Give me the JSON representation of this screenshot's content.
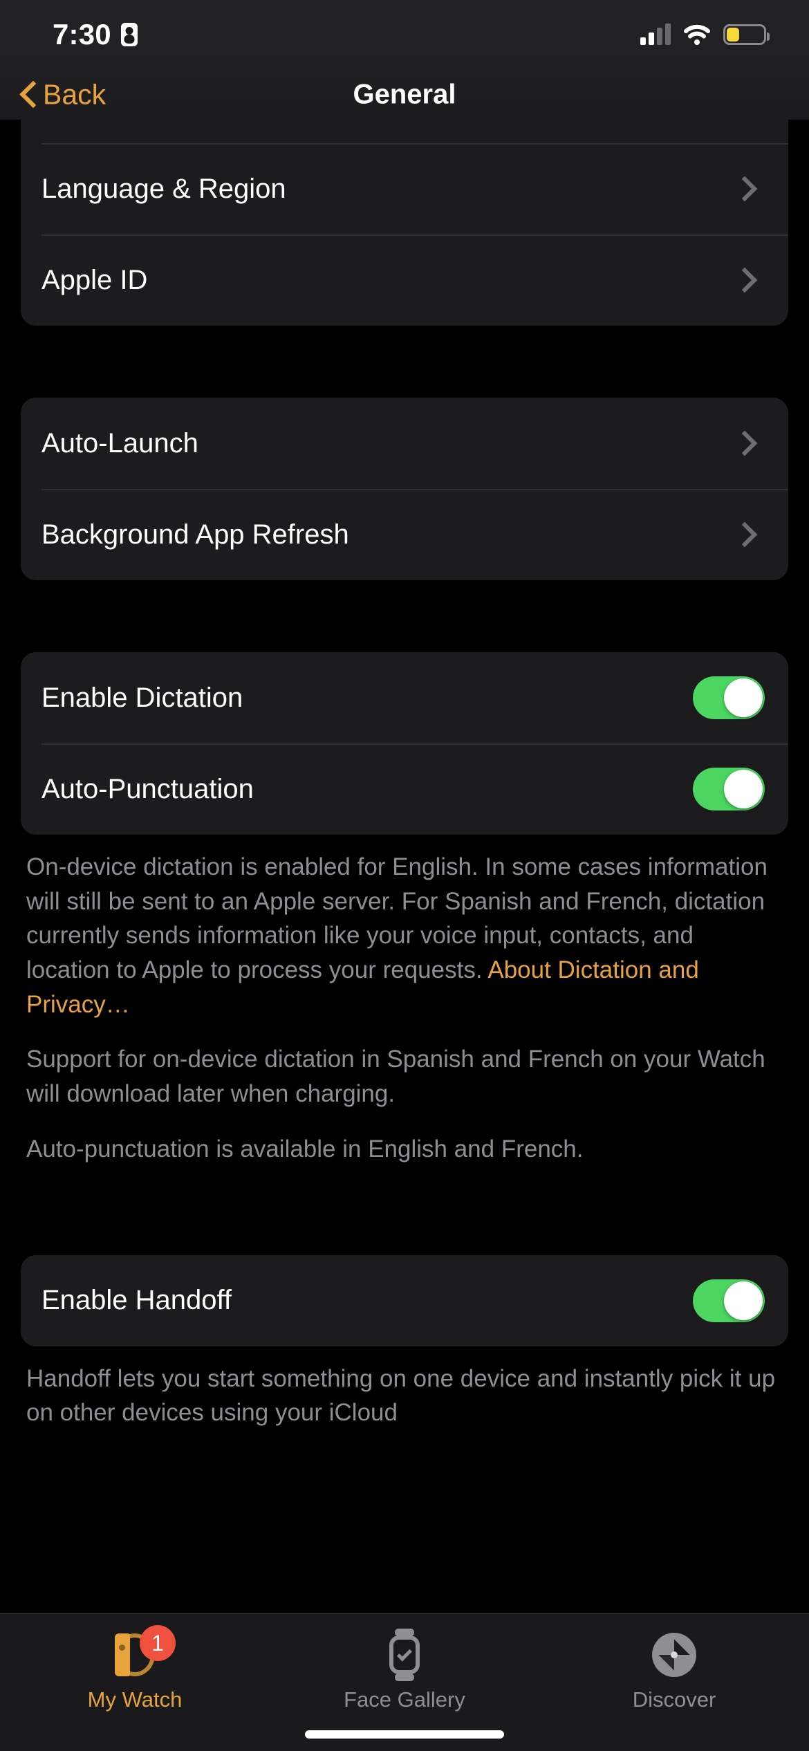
{
  "status_bar": {
    "time": "7:30",
    "recording_icon": "recording-indicator-icon",
    "cellular_icon": "cellular-signal-icon",
    "wifi_icon": "wifi-icon",
    "battery_icon": "battery-low-power-icon",
    "battery_color": "#f5d83a"
  },
  "nav": {
    "back_label": "Back",
    "title": "General",
    "accent_color": "#e8a33d"
  },
  "sections": {
    "group1": {
      "rows": [
        {
          "label": "Language & Region",
          "accessory": "chevron"
        },
        {
          "label": "Apple ID",
          "accessory": "chevron"
        }
      ]
    },
    "group2": {
      "rows": [
        {
          "label": "Auto-Launch",
          "accessory": "chevron"
        },
        {
          "label": "Background App Refresh",
          "accessory": "chevron"
        }
      ]
    },
    "group3": {
      "rows": [
        {
          "label": "Enable Dictation",
          "accessory": "toggle",
          "value": "on"
        },
        {
          "label": "Auto-Punctuation",
          "accessory": "toggle",
          "value": "on"
        }
      ],
      "footer": {
        "paragraph1_text": "On-device dictation is enabled for English. In some cases information will still be sent to an Apple server. For Spanish and French, dictation currently sends information like your voice input, contacts, and location to Apple to process your requests. ",
        "paragraph1_link": "About Dictation and Privacy…",
        "paragraph2": "Support for on-device dictation in Spanish and French on your Watch will download later when charging.",
        "paragraph3": "Auto-punctuation is available in English and French."
      }
    },
    "group4": {
      "rows": [
        {
          "label": "Enable Handoff",
          "accessory": "toggle",
          "value": "on"
        }
      ],
      "footer": {
        "paragraph1": "Handoff lets you start something on one device and instantly pick it up on other devices using your iCloud"
      }
    }
  },
  "toggle_on_color": "#4cd661",
  "tab_bar": {
    "tabs": [
      {
        "label": "My Watch",
        "icon": "apple-watch-side-icon",
        "active": true,
        "badge": "1"
      },
      {
        "label": "Face Gallery",
        "icon": "watch-face-check-icon",
        "active": false
      },
      {
        "label": "Discover",
        "icon": "compass-icon",
        "active": false
      }
    ],
    "badge_color": "#f0513f",
    "active_color": "#e8a33d",
    "inactive_color": "#8e8e93"
  }
}
